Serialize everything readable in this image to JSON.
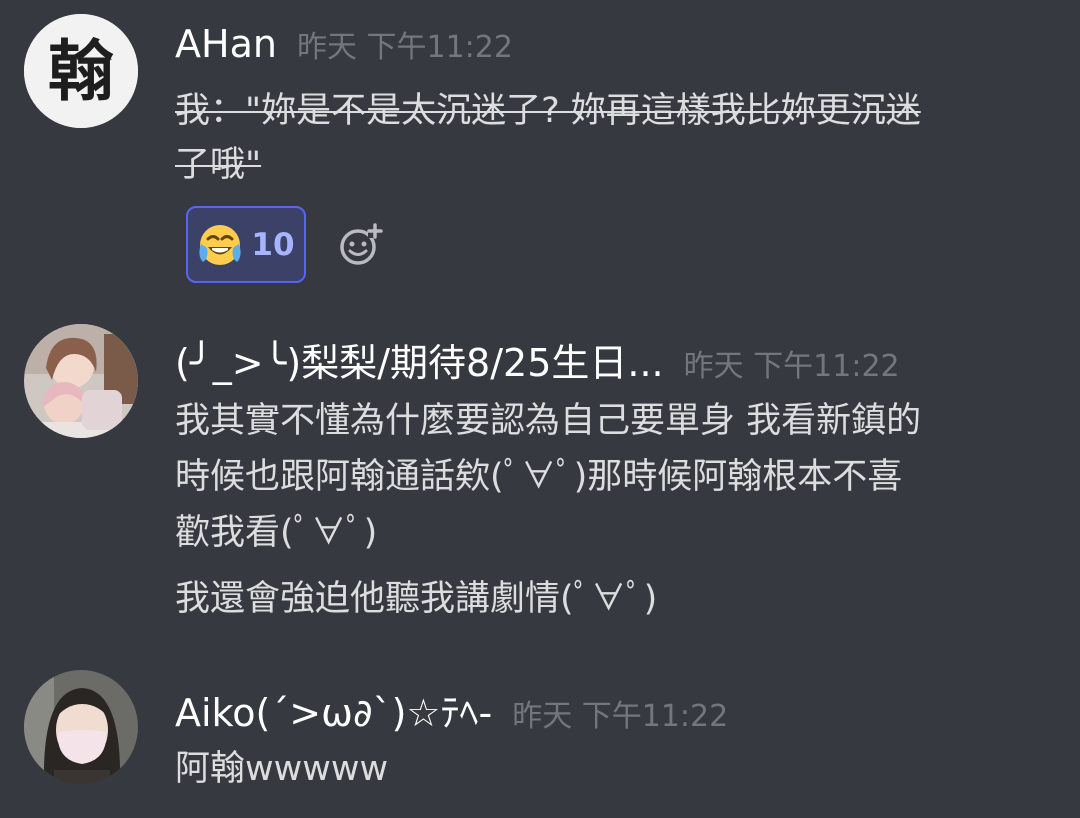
{
  "messages": [
    {
      "author": "AHan",
      "timestamp": "昨天 下午11:22",
      "avatar_char": "翰",
      "lines": [
        "我：\"妳是不是太沉迷了? 妳再這樣我比妳更沉迷",
        "了哦\""
      ],
      "strikethrough": true,
      "reaction": {
        "emoji": "joy-emoji",
        "count": "10"
      },
      "add_reaction_icon": "add-reaction-icon"
    },
    {
      "author": "(╯_>╰)梨梨/期待8/25生日...",
      "timestamp": "昨天 下午11:22",
      "lines": [
        "我其實不懂為什麼要認為自己要單身 我看新鎮的",
        "時候也跟阿翰通話欸(ﾟ∀ﾟ)那時候阿翰根本不喜",
        "歡我看(ﾟ∀ﾟ)",
        "我還會強迫他聽我講劇情(ﾟ∀ﾟ)"
      ]
    },
    {
      "author": "Aiko(´>ω∂`)☆ﾃﾍ-",
      "timestamp": "昨天 下午11:22",
      "lines": [
        "阿翰wwwww"
      ]
    }
  ],
  "colors": {
    "background": "#36393f",
    "author": "#ffffff",
    "timestamp": "#72767d",
    "text": "#dcddde",
    "reaction_bg": "#3b4167",
    "reaction_border": "#5865f2",
    "reaction_count": "#a7b4ff"
  }
}
